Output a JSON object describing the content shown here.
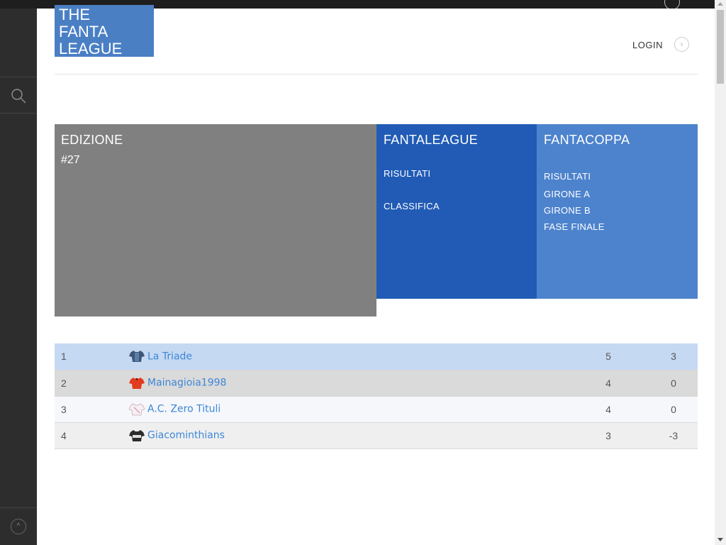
{
  "logo": {
    "line1": "THE",
    "line2": "FANTA",
    "line3": "LEAGUE"
  },
  "header": {
    "login_label": "LOGIN",
    "login_icon": "chevron-right-icon"
  },
  "sidebar": {
    "search_icon": "search-icon",
    "top_icon": "chevron-up-icon"
  },
  "tiles": {
    "edizione": {
      "title": "EDIZIONE",
      "number": "#27"
    },
    "fantaleague": {
      "title": "FANTALEAGUE",
      "links": [
        "RISULTATI",
        "CLASSIFICA"
      ]
    },
    "fantacoppa": {
      "title": "FANTACOPPA",
      "links": [
        "RISULTATI",
        "GIRONE A",
        "GIRONE B",
        "FASE FINALE"
      ]
    }
  },
  "standings": [
    {
      "pos": "1",
      "team": "La Triade",
      "points": "5",
      "diff": "3"
    },
    {
      "pos": "2",
      "team": "Mainagioia1998",
      "points": "4",
      "diff": "0"
    },
    {
      "pos": "3",
      "team": "A.C. Zero Tituli",
      "points": "4",
      "diff": "0"
    },
    {
      "pos": "4",
      "team": "Giacominthians",
      "points": "3",
      "diff": "-3"
    }
  ],
  "colors": {
    "tile_gray": "#808080",
    "tile_blue_dark": "#215bb5",
    "tile_blue_light": "#4d83cd",
    "logo_blue": "#4a7fc4",
    "link_blue": "#3d86d6",
    "row_highlight": "#c5d9f3"
  }
}
